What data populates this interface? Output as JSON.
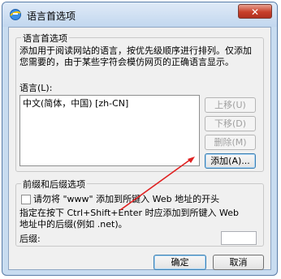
{
  "window": {
    "title": "语言首选项",
    "close_glyph": "✕"
  },
  "lang_group": {
    "label": "语言首选项",
    "description_line1": "添加用于阅读网站的语言，按优先级顺序进行排列。仅添加",
    "description_line2": "您需要的，由于某些字符会模仿网页的正确语言显示。",
    "list_label": "语言(L):",
    "languages": [
      "中文(简体，中国) [zh-CN]"
    ]
  },
  "side_buttons": {
    "move_up": "上移(U)",
    "move_down": "下移(D)",
    "remove": "删除(M)",
    "add": "添加(A)..."
  },
  "prefix_group": {
    "label": "前缀和后缀选项",
    "checkbox_label": "请勿将 \"www\" 添加到所键入 Web 地址的开头",
    "hint_line1": "指定在按下 Ctrl+Shift+Enter 时应添加到所键入 Web",
    "hint_line2": "地址中的后缀(例如 .net)。",
    "suffix_label": "后缀:",
    "suffix_value": ""
  },
  "footer": {
    "ok": "确定",
    "cancel": "取消"
  },
  "colors": {
    "arrow": "#e02020",
    "frame": "#c8dcf0"
  }
}
